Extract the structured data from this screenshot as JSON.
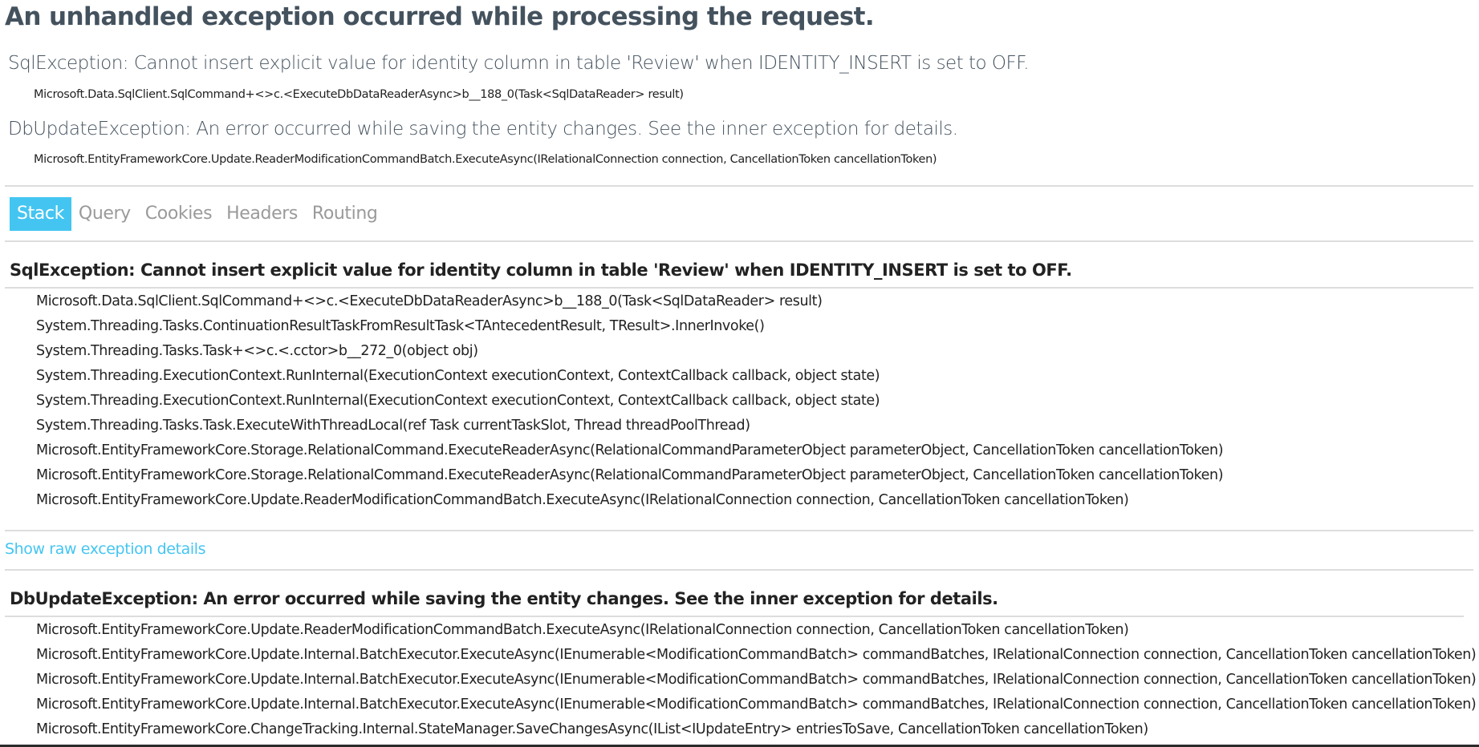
{
  "page": {
    "title": "An unhandled exception occurred while processing the request."
  },
  "summary": [
    {
      "message": "SqlException: Cannot insert explicit value for identity column in table 'Review' when IDENTITY_INSERT is set to OFF.",
      "frame": "Microsoft.Data.SqlClient.SqlCommand+<>c.<ExecuteDbDataReaderAsync>b__188_0(Task<SqlDataReader> result)"
    },
    {
      "message": "DbUpdateException: An error occurred while saving the entity changes. See the inner exception for details.",
      "frame": "Microsoft.EntityFrameworkCore.Update.ReaderModificationCommandBatch.ExecuteAsync(IRelationalConnection connection, CancellationToken cancellationToken)"
    }
  ],
  "tabs": [
    {
      "label": "Stack",
      "active": true
    },
    {
      "label": "Query",
      "active": false
    },
    {
      "label": "Cookies",
      "active": false
    },
    {
      "label": "Headers",
      "active": false
    },
    {
      "label": "Routing",
      "active": false
    }
  ],
  "stack": {
    "exceptions": [
      {
        "heading": "SqlException: Cannot insert explicit value for identity column in table 'Review' when IDENTITY_INSERT is set to OFF.",
        "frames": [
          "Microsoft.Data.SqlClient.SqlCommand+<>c.<ExecuteDbDataReaderAsync>b__188_0(Task<SqlDataReader> result)",
          "System.Threading.Tasks.ContinuationResultTaskFromResultTask<TAntecedentResult, TResult>.InnerInvoke()",
          "System.Threading.Tasks.Task+<>c.<.cctor>b__272_0(object obj)",
          "System.Threading.ExecutionContext.RunInternal(ExecutionContext executionContext, ContextCallback callback, object state)",
          "System.Threading.ExecutionContext.RunInternal(ExecutionContext executionContext, ContextCallback callback, object state)",
          "System.Threading.Tasks.Task.ExecuteWithThreadLocal(ref Task currentTaskSlot, Thread threadPoolThread)",
          "Microsoft.EntityFrameworkCore.Storage.RelationalCommand.ExecuteReaderAsync(RelationalCommandParameterObject parameterObject, CancellationToken cancellationToken)",
          "Microsoft.EntityFrameworkCore.Storage.RelationalCommand.ExecuteReaderAsync(RelationalCommandParameterObject parameterObject, CancellationToken cancellationToken)",
          "Microsoft.EntityFrameworkCore.Update.ReaderModificationCommandBatch.ExecuteAsync(IRelationalConnection connection, CancellationToken cancellationToken)"
        ],
        "raw_link": "Show raw exception details"
      },
      {
        "heading": "DbUpdateException: An error occurred while saving the entity changes. See the inner exception for details.",
        "frames": [
          "Microsoft.EntityFrameworkCore.Update.ReaderModificationCommandBatch.ExecuteAsync(IRelationalConnection connection, CancellationToken cancellationToken)",
          "Microsoft.EntityFrameworkCore.Update.Internal.BatchExecutor.ExecuteAsync(IEnumerable<ModificationCommandBatch> commandBatches, IRelationalConnection connection, CancellationToken cancellationToken)",
          "Microsoft.EntityFrameworkCore.Update.Internal.BatchExecutor.ExecuteAsync(IEnumerable<ModificationCommandBatch> commandBatches, IRelationalConnection connection, CancellationToken cancellationToken)",
          "Microsoft.EntityFrameworkCore.Update.Internal.BatchExecutor.ExecuteAsync(IEnumerable<ModificationCommandBatch> commandBatches, IRelationalConnection connection, CancellationToken cancellationToken)",
          "Microsoft.EntityFrameworkCore.ChangeTracking.Internal.StateManager.SaveChangesAsync(IList<IUpdateEntry> entriesToSave, CancellationToken cancellationToken)"
        ]
      }
    ]
  },
  "colors": {
    "title": "#44525e",
    "accent": "#44c5f1",
    "tab_inactive": "#9a9a9a",
    "divider": "#dddddd"
  }
}
